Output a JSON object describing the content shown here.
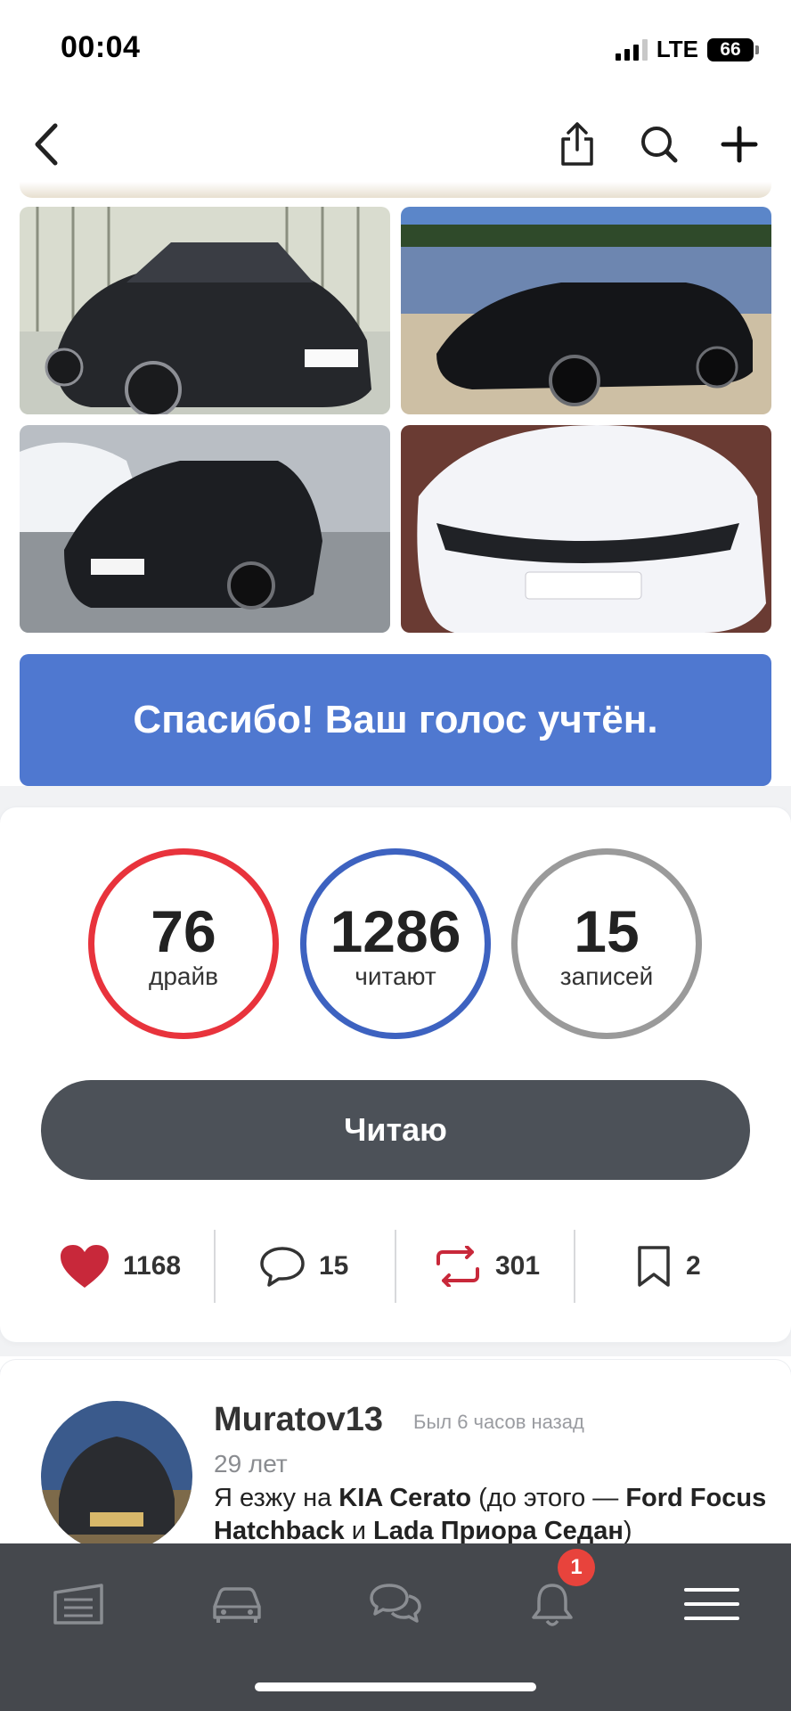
{
  "status_bar": {
    "time": "00:04",
    "network": "LTE",
    "battery": "66"
  },
  "nav": {
    "back_icon": "chevron-left-icon",
    "share_icon": "share-icon",
    "search_icon": "search-icon",
    "add_icon": "plus-icon"
  },
  "photos": [
    {
      "alt": "Black KIA Cerato sketch-style photo"
    },
    {
      "alt": "Black KIA Cerato by the lake"
    },
    {
      "alt": "Black KIA Cerato in the snowy lot"
    },
    {
      "alt": "Snow-covered KIA Cerato"
    }
  ],
  "vote_banner": {
    "text": "Спасибо! Ваш голос учтён.",
    "color": "#4f78d0"
  },
  "stats": {
    "drive": {
      "value": "76",
      "label": "драйв",
      "color": "#e8333c"
    },
    "readers": {
      "value": "1286",
      "label": "читают",
      "color": "#3d62c0"
    },
    "posts": {
      "value": "15",
      "label": "записей",
      "color": "#9a9a9a"
    }
  },
  "read_button": {
    "label": "Читаю"
  },
  "actions": {
    "likes": "1168",
    "comments": "15",
    "reposts": "301",
    "bookmarks": "2"
  },
  "profile": {
    "username": "Muratov13",
    "last_seen": "Был 6 часов назад",
    "age": "29 лет",
    "drives_prefix": "Я езжу на ",
    "car_current": "KIA Cerato",
    "drives_mid": " (до этого — ",
    "car_prev_1": "Ford Focus Hatchback",
    "drives_and": " и ",
    "car_prev_2": "Lada Приора Седан",
    "drives_suffix": ")"
  },
  "tabbar": {
    "items": [
      "garage-icon",
      "car-icon",
      "chat-icon",
      "bell-icon",
      "menu-icon"
    ],
    "notification_count": "1"
  }
}
